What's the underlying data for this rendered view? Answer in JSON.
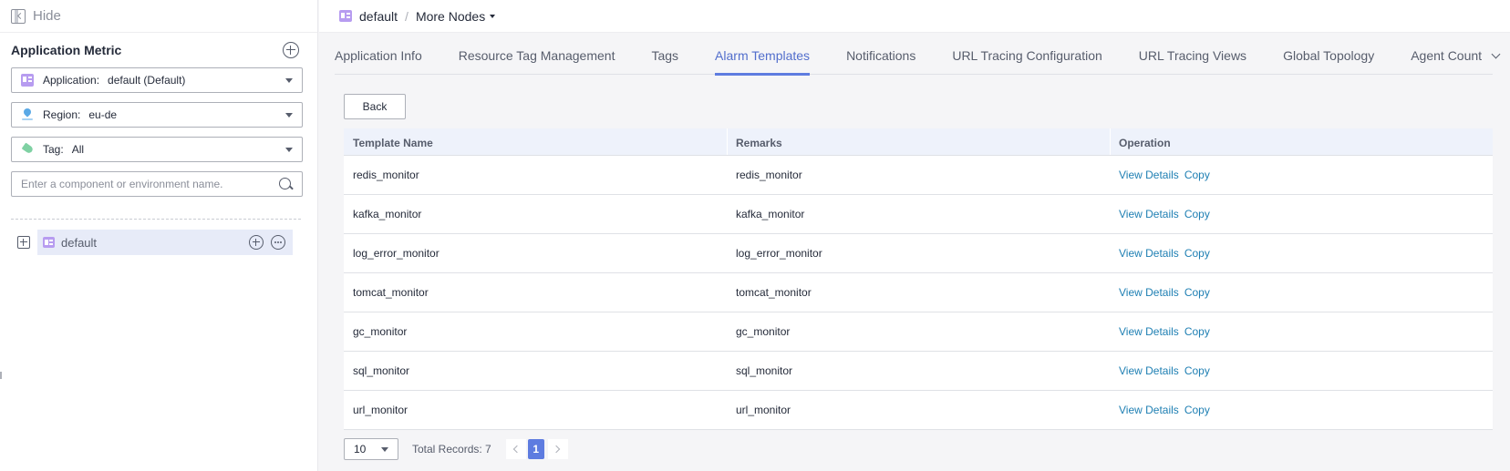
{
  "sidebar": {
    "hide_label": "Hide",
    "title": "Application Metric",
    "filters": [
      {
        "label": "Application:",
        "value": "default (Default)",
        "icon": "application-icon"
      },
      {
        "label": "Region:",
        "value": "eu-de",
        "icon": "location-pin-icon"
      },
      {
        "label": "Tag:",
        "value": "All",
        "icon": "tag-icon"
      }
    ],
    "search": {
      "placeholder": "Enter a component or environment name.",
      "value": ""
    },
    "tree": [
      {
        "label": "default",
        "icon": "application-icon",
        "selected": true
      }
    ]
  },
  "breadcrumb": {
    "current": "default",
    "separator": "/",
    "more": "More Nodes"
  },
  "tabs": [
    {
      "label": "Application Info",
      "active": false
    },
    {
      "label": "Resource Tag Management",
      "active": false
    },
    {
      "label": "Tags",
      "active": false
    },
    {
      "label": "Alarm Templates",
      "active": true
    },
    {
      "label": "Notifications",
      "active": false
    },
    {
      "label": "URL Tracing Configuration",
      "active": false
    },
    {
      "label": "URL Tracing Views",
      "active": false
    },
    {
      "label": "Global Topology",
      "active": false
    },
    {
      "label": "Agent Count",
      "active": false
    }
  ],
  "back_label": "Back",
  "table": {
    "columns": [
      "Template Name",
      "Remarks",
      "Operation"
    ],
    "rows": [
      {
        "name": "redis_monitor",
        "remarks": "redis_monitor"
      },
      {
        "name": "kafka_monitor",
        "remarks": "kafka_monitor"
      },
      {
        "name": "log_error_monitor",
        "remarks": "log_error_monitor"
      },
      {
        "name": "tomcat_monitor",
        "remarks": "tomcat_monitor"
      },
      {
        "name": "gc_monitor",
        "remarks": "gc_monitor"
      },
      {
        "name": "sql_monitor",
        "remarks": "sql_monitor"
      },
      {
        "name": "url_monitor",
        "remarks": "url_monitor"
      }
    ],
    "actions": {
      "view": "View Details",
      "copy": "Copy"
    }
  },
  "pagination": {
    "page_size": "10",
    "total_label": "Total Records: 7",
    "current_page": "1"
  },
  "colors": {
    "accent": "#5e7ce0",
    "link": "#1e7fb3",
    "active_tab_text": "#526ecc",
    "table_header_bg": "#eef2fb",
    "selected_node_bg": "#e7ebf8"
  }
}
